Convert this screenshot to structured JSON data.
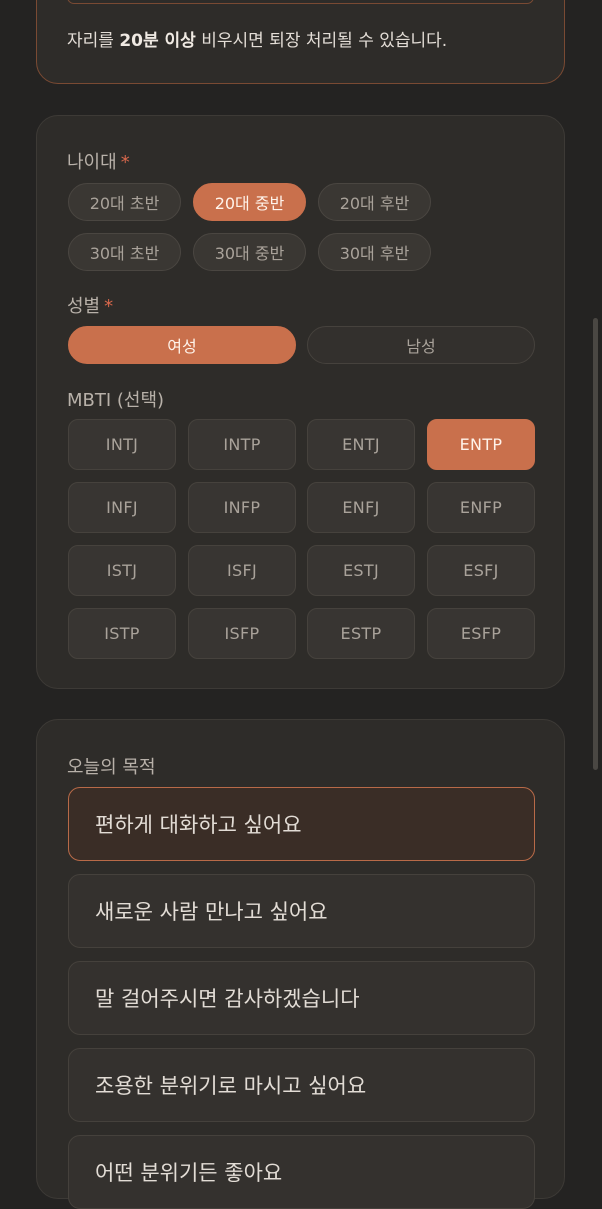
{
  "notice": {
    "prefix": "자리를 ",
    "bold": "20분 이상",
    "suffix": " 비우시면 퇴장 처리될 수 있습니다."
  },
  "form": {
    "age": {
      "label": "나이대",
      "required_mark": "*",
      "options": [
        "20대 초반",
        "20대 중반",
        "20대 후반",
        "30대 초반",
        "30대 중반",
        "30대 후반"
      ],
      "selected": "20대 중반"
    },
    "gender": {
      "label": "성별",
      "required_mark": "*",
      "options": [
        "여성",
        "남성"
      ],
      "selected": "여성"
    },
    "mbti": {
      "label": "MBTI (선택)",
      "options": [
        "INTJ",
        "INTP",
        "ENTJ",
        "ENTP",
        "INFJ",
        "INFP",
        "ENFJ",
        "ENFP",
        "ISTJ",
        "ISFJ",
        "ESTJ",
        "ESFJ",
        "ISTP",
        "ISFP",
        "ESTP",
        "ESFP"
      ],
      "selected": "ENTP"
    }
  },
  "purpose": {
    "label": "오늘의 목적",
    "options": [
      "편하게 대화하고 싶어요",
      "새로운 사람 만나고 싶어요",
      "말 걸어주시면 감사하겠습니다",
      "조용한 분위기로 마시고 싶어요",
      "어떤 분위기든 좋아요"
    ],
    "selected": "편하게 대화하고 싶어요"
  },
  "colors": {
    "accent": "#c9704c",
    "background": "#242322",
    "card": "#2e2c29",
    "required": "#d9684c"
  }
}
